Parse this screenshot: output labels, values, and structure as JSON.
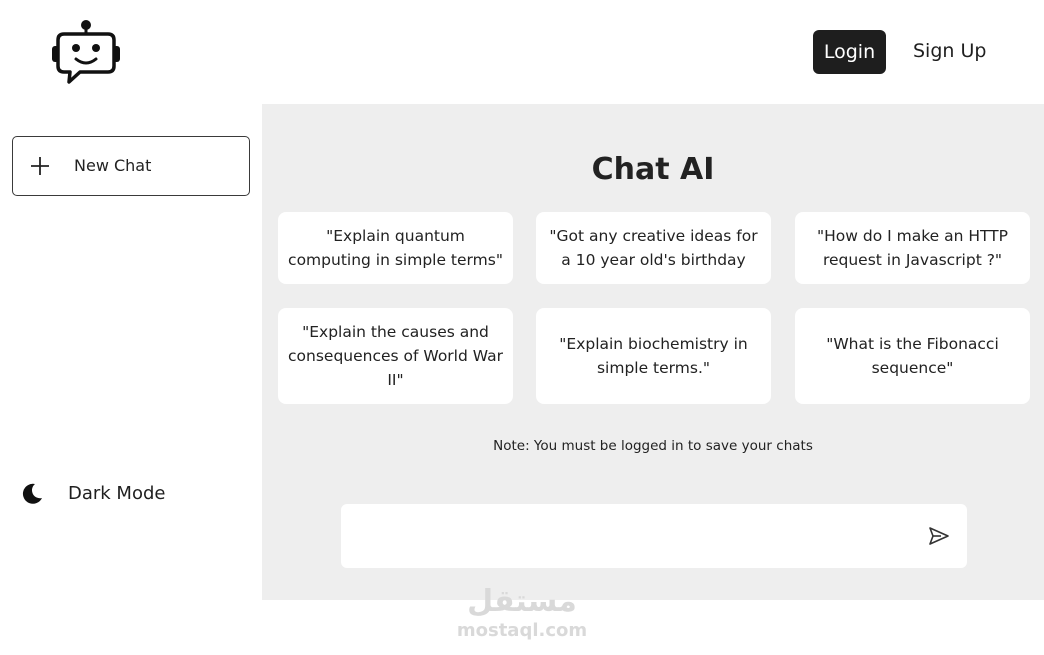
{
  "header": {
    "logo_icon": "robot-chat-logo-icon",
    "login_label": "Login",
    "signup_label": "Sign Up"
  },
  "sidebar": {
    "new_chat_label": "New Chat",
    "new_chat_icon": "plus-icon",
    "dark_mode_label": "Dark Mode",
    "dark_mode_icon": "moon-icon"
  },
  "main": {
    "title": "Chat AI",
    "suggestions": [
      "\"Explain quantum computing in simple terms\"",
      "\"Got any creative ideas for a 10 year old's birthday",
      "\"How do I make an HTTP request in Javascript ?\"",
      "\"Explain the causes and consequences of World War II\"",
      "\"Explain biochemistry in simple terms.\"",
      "\"What is the Fibonacci sequence\""
    ],
    "note": "Note: You must be logged in to save your chats",
    "input_value": "",
    "send_icon": "send-icon"
  },
  "watermark": {
    "arabic": "مستقل",
    "latin": "mostaql.com"
  },
  "colors": {
    "panel_bg": "#eeeeee",
    "login_bg": "#1e1e1e",
    "text": "#1f1f1f",
    "watermark": "#d9d9d9"
  }
}
